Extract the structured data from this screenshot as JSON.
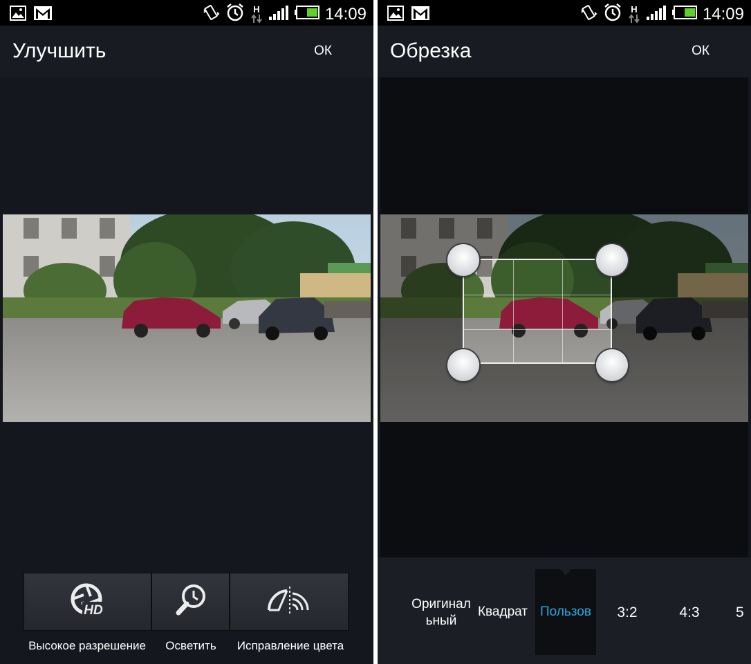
{
  "status": {
    "time": "14:09",
    "network": "H"
  },
  "enhance": {
    "title": "Улучшить",
    "ok_label": "ОК",
    "tools": [
      {
        "label": "Высокое разрешение",
        "icon": "hd-aperture-icon"
      },
      {
        "label": "Осветить",
        "icon": "brighten-magnifier-icon"
      },
      {
        "label": "Исправление цвета",
        "icon": "color-correction-icon"
      }
    ]
  },
  "crop": {
    "title": "Обрезка",
    "ok_label": "ОК",
    "options": [
      {
        "label": "Оригинальный",
        "line1": "Оригинал",
        "line2": "ьный"
      },
      {
        "label": "Квадрат"
      },
      {
        "label": "Пользов",
        "selected": true
      },
      {
        "label": "3:2"
      },
      {
        "label": "4:3"
      },
      {
        "label": "5"
      }
    ]
  },
  "colors": {
    "accent": "#29a8e0",
    "background": "#14171d",
    "statusbar": "#000000"
  }
}
